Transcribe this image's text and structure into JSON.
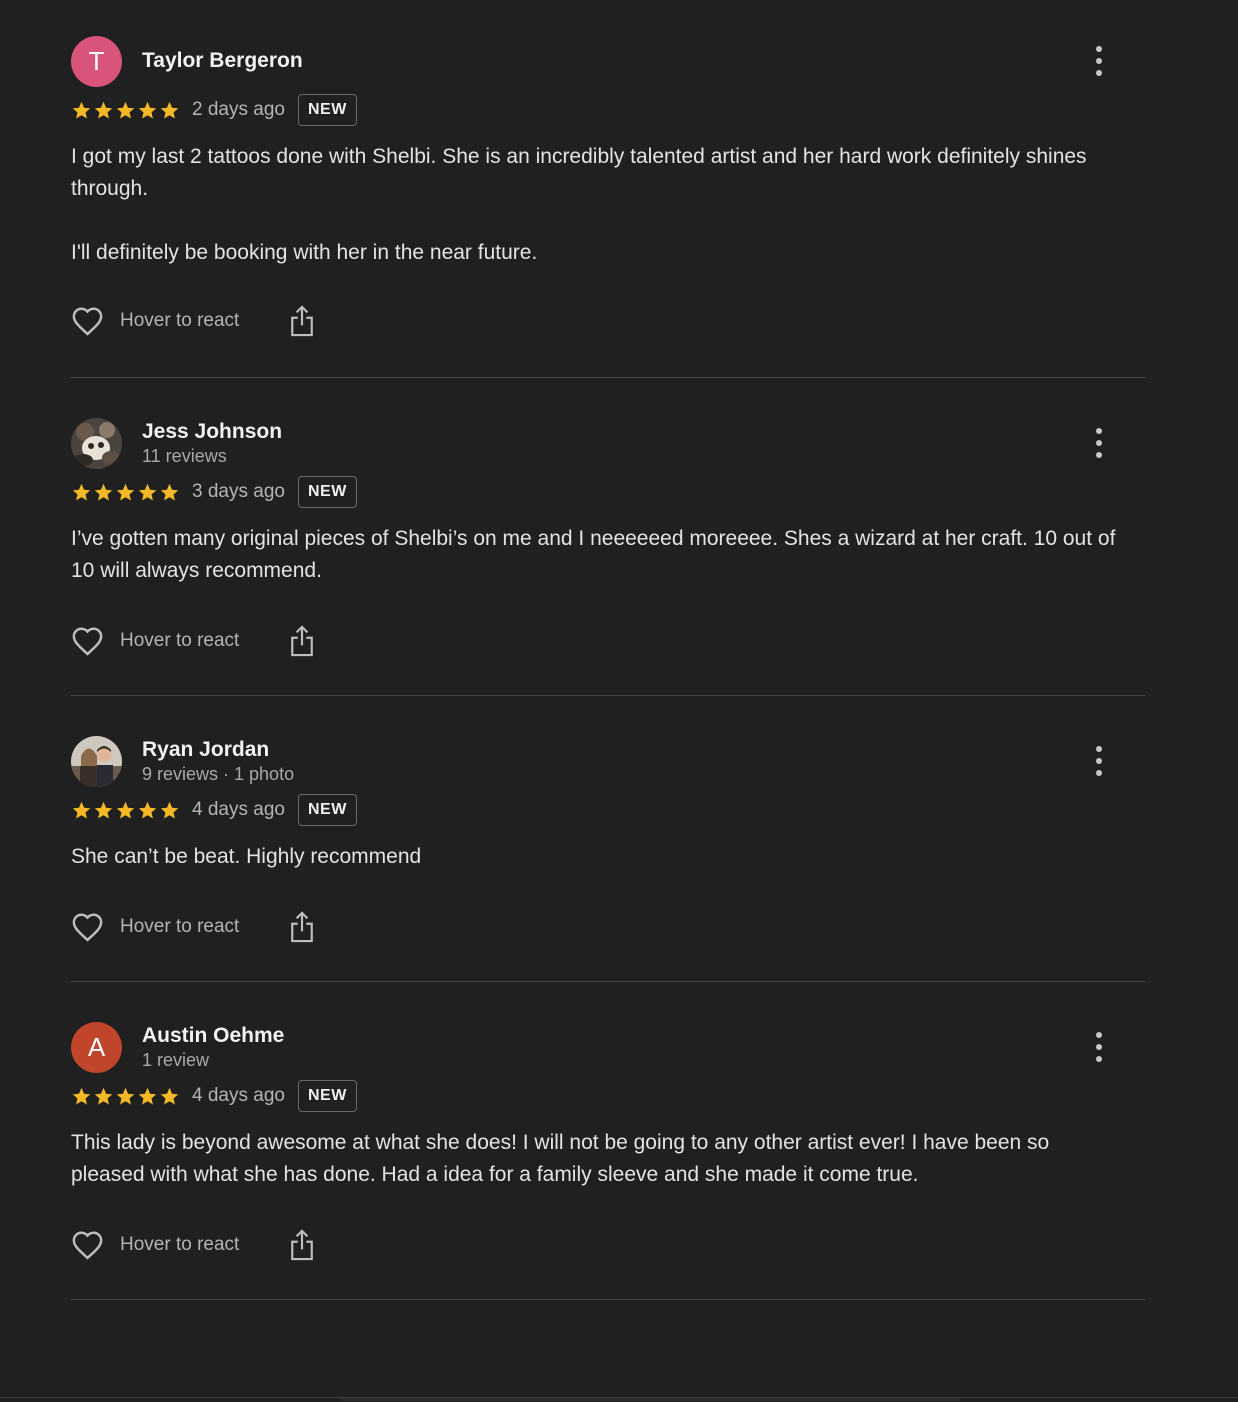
{
  "reviews": [
    {
      "name": "Taylor Bergeron",
      "subline": "",
      "avatar": {
        "type": "letter",
        "letter": "T",
        "color": "#d9547a"
      },
      "rating": 5,
      "date": "2 days ago",
      "badge": "NEW",
      "text": "I got my last 2 tattoos done with Shelbi. She is an incredibly talented artist and her hard work definitely shines through.\n\nI'll definitely be booking with her in the near future.",
      "react_label": "Hover to react"
    },
    {
      "name": "Jess Johnson",
      "subline": "11 reviews",
      "avatar": {
        "type": "photo"
      },
      "rating": 5,
      "date": "3 days ago",
      "badge": "NEW",
      "text": "I’ve gotten many original pieces of Shelbi’s on me and I neeeeeed moreeee. Shes a wizard at her craft. 10 out of 10 will always recommend.",
      "react_label": "Hover to react"
    },
    {
      "name": "Ryan Jordan",
      "subline": "9 reviews · 1 photo",
      "avatar": {
        "type": "photo"
      },
      "rating": 5,
      "date": "4 days ago",
      "badge": "NEW",
      "text": "She can’t be beat. Highly recommend",
      "react_label": "Hover to react"
    },
    {
      "name": "Austin Oehme",
      "subline": "1 review",
      "avatar": {
        "type": "letter",
        "letter": "A",
        "color": "#c0452a"
      },
      "rating": 5,
      "date": "4 days ago",
      "badge": "NEW",
      "text": "This lady is beyond awesome at what she does! I will not be going to any other artist ever! I have been so pleased with what she has done. Had a idea for a family sleeve and she made it come true.",
      "react_label": "Hover to react"
    }
  ],
  "colors": {
    "background": "#202020",
    "star": "#f5b928",
    "divider": "#474747"
  },
  "icons": {
    "star": "star-icon",
    "heart": "heart-outline-icon",
    "share": "share-icon",
    "more": "more-vertical-icon"
  }
}
